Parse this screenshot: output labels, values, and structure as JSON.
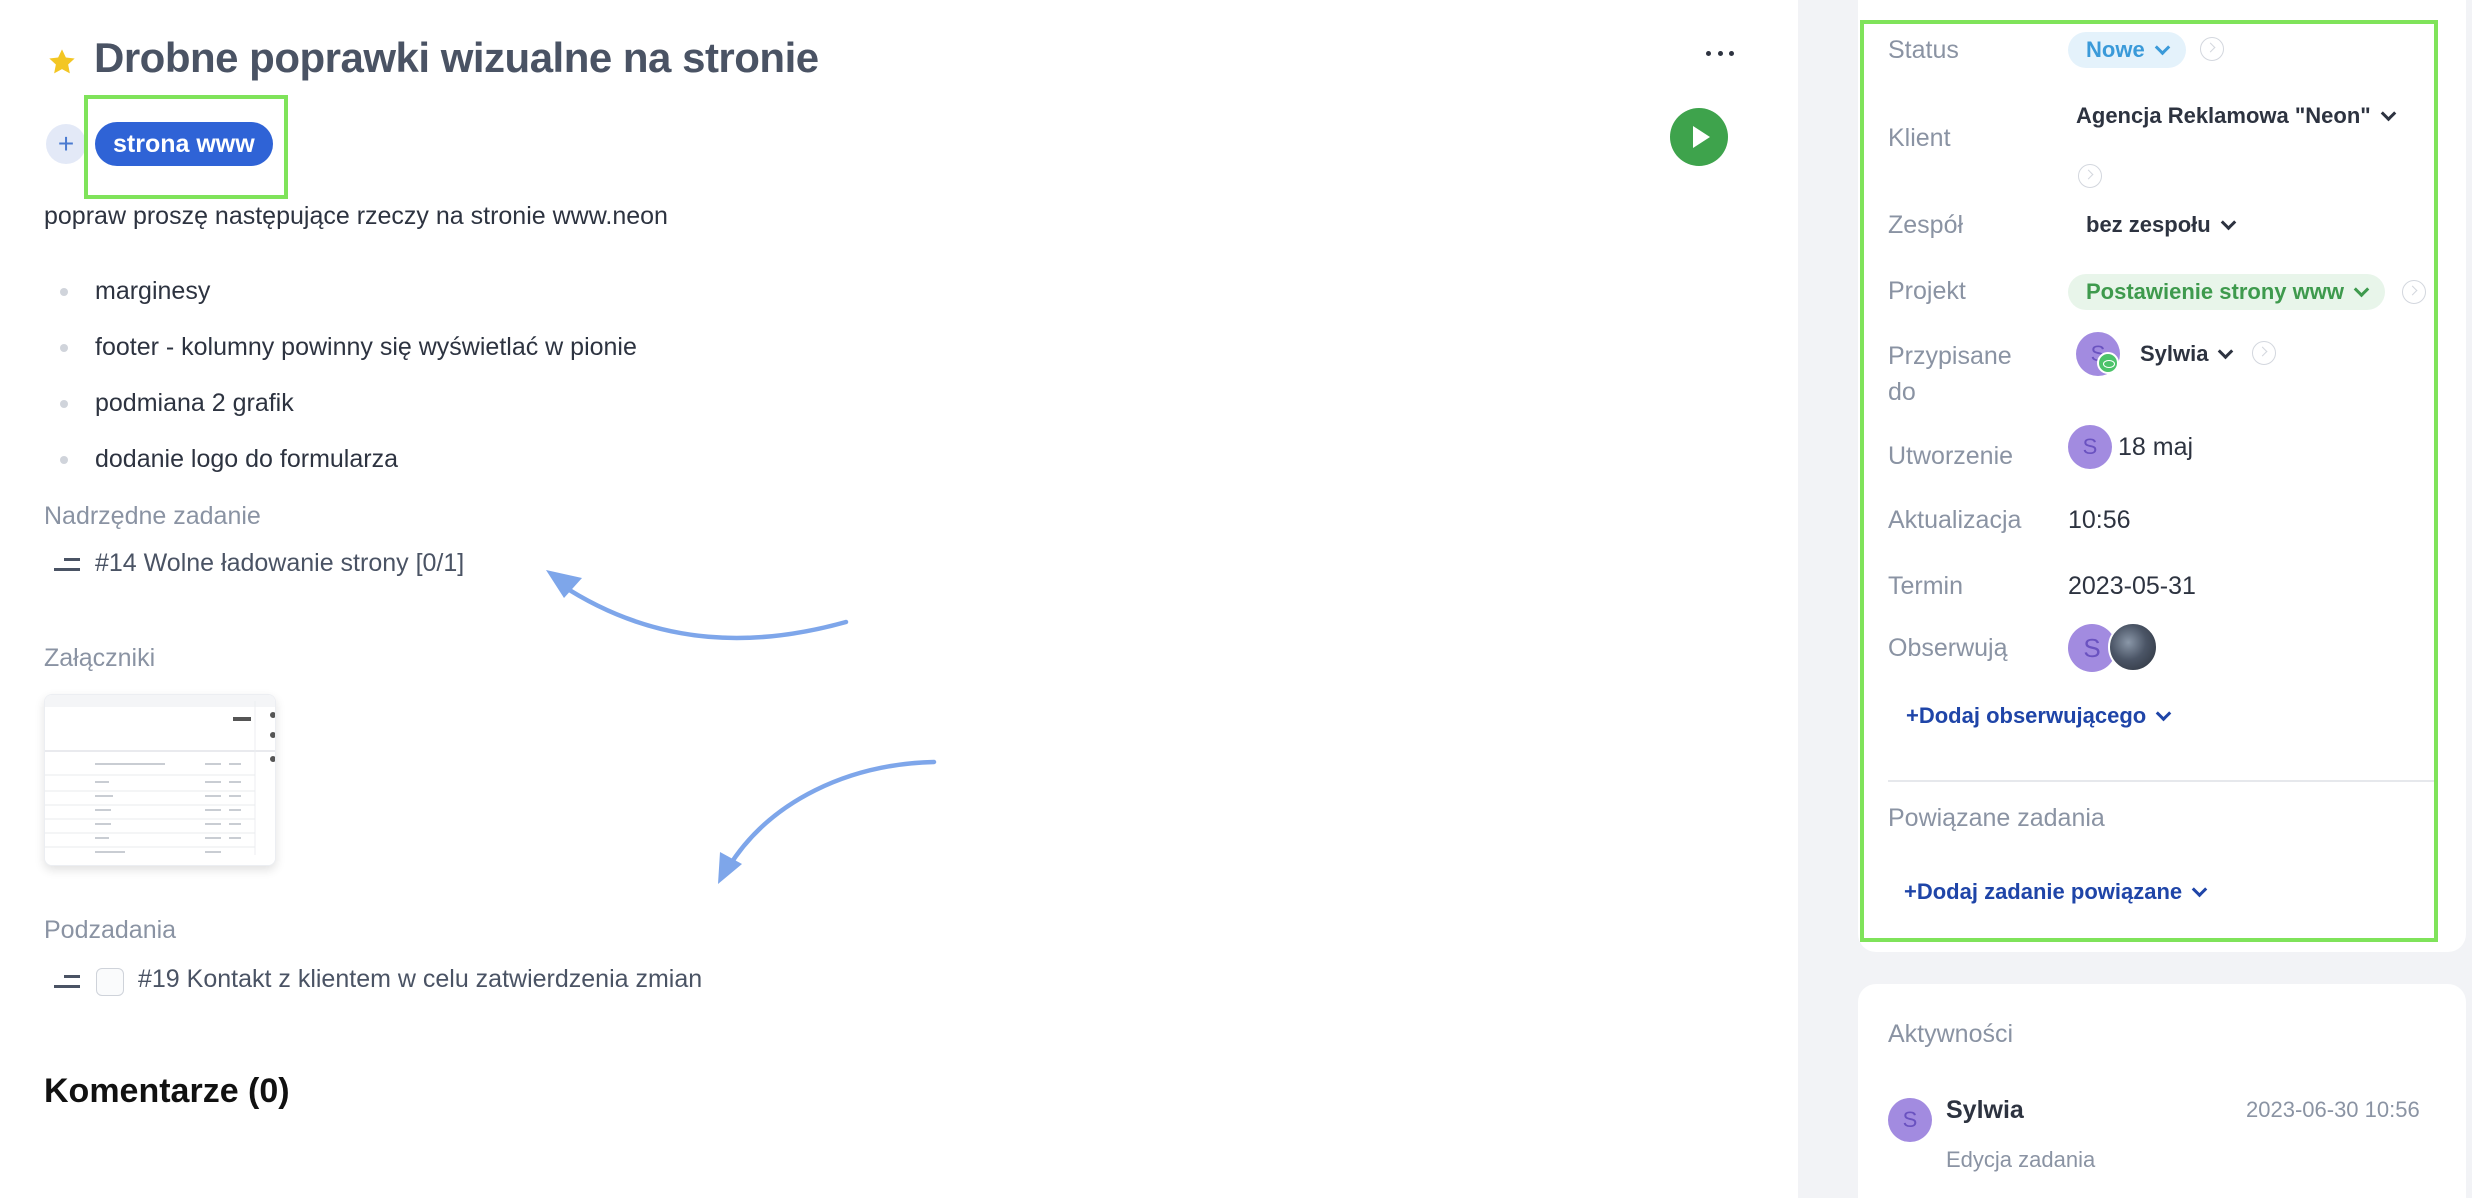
{
  "task": {
    "title": "Drobne poprawki wizualne na stronie",
    "tag": "strona www",
    "add_tag_symbol": "+",
    "description": "popraw proszę następujące rzeczy na stronie www.neon",
    "bullets": [
      "marginesy",
      "footer - kolumny powinny się wyświetlać w pionie",
      "podmiana 2 grafik",
      "dodanie logo do formularza"
    ],
    "parent_label": "Nadrzędne zadanie",
    "parent_task": "#14 Wolne ładowanie strony [0/1]",
    "attachments_label": "Załączniki",
    "subtasks_label": "Podzadania",
    "subtask": "#19 Kontakt z klientem w celu zatwierdzenia zmian",
    "comments_heading": "Komentarze (0)"
  },
  "details": {
    "status_label": "Status",
    "status_value": "Nowe",
    "client_label": "Klient",
    "client_value": "Agencja Reklamowa \"Neon\"",
    "team_label": "Zespół",
    "team_value": "bez zespołu",
    "project_label": "Projekt",
    "project_value": "Postawienie strony www",
    "assigned_label_1": "Przypisane",
    "assigned_label_2": "do",
    "assigned_value": "Sylwia",
    "assigned_avatar": "S",
    "created_label": "Utworzenie",
    "created_avatar": "S",
    "created_value": "18 maj",
    "updated_label": "Aktualizacja",
    "updated_value": "10:56",
    "deadline_label": "Termin",
    "deadline_value": "2023-05-31",
    "observers_label": "Obserwują",
    "observer_avatar": "S",
    "add_observer": "+Dodaj obserwującego",
    "related_label": "Powiązane zadania",
    "add_related": "+Dodaj zadanie powiązane"
  },
  "activity": {
    "heading": "Aktywności",
    "user_avatar": "S",
    "user": "Sylwia",
    "timestamp": "2023-06-30 10:56",
    "action": "Edycja zadania"
  },
  "colors": {
    "tag": "#2f63d6",
    "play": "#3ea34c",
    "highlight": "#7fe35a",
    "status_pill": "#e4f2fb",
    "project_pill": "#e8f5ea",
    "arrow": "#7ea6ea"
  },
  "icons": {
    "star": "star-icon",
    "more": "more-horizontal-icon",
    "play": "play-icon",
    "add": "plus-icon",
    "task_lines": "task-lines-icon",
    "chevron": "chevron-down-icon",
    "go_to": "circle-arrow-icon",
    "watch": "eye-icon"
  }
}
